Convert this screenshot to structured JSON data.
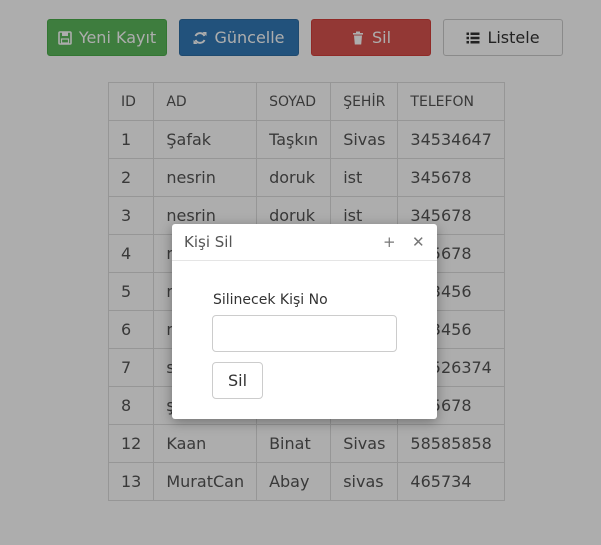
{
  "toolbar": {
    "new_label": "Yeni Kayıt",
    "update_label": "Güncelle",
    "delete_label": "Sil",
    "list_label": "Listele",
    "colors": {
      "success": "#5cb85c",
      "primary": "#337ab7",
      "danger": "#d9534f",
      "default": "#ffffff"
    }
  },
  "table": {
    "headers": [
      "ID",
      "AD",
      "SOYAD",
      "ŞEHİR",
      "TELEFON"
    ],
    "rows": [
      [
        "1",
        "Şafak",
        "Taşkın",
        "Sivas",
        "34534647"
      ],
      [
        "2",
        "nesrin",
        "doruk",
        "ist",
        "345678"
      ],
      [
        "3",
        "nesrin",
        "doruk",
        "ist",
        "345678"
      ],
      [
        "4",
        "n",
        "",
        "",
        "345678"
      ],
      [
        "5",
        "n",
        "",
        "",
        "123456"
      ],
      [
        "6",
        "n",
        "",
        "",
        "123456"
      ],
      [
        "7",
        "s",
        "",
        "",
        "12526374"
      ],
      [
        "8",
        "ş",
        "",
        "",
        "345678"
      ],
      [
        "12",
        "Kaan",
        "Binat",
        "Sivas",
        "58585858"
      ],
      [
        "13",
        "MuratCan",
        "Abay",
        "sivas",
        "465734"
      ]
    ]
  },
  "dialog": {
    "title": "Kişi Sil",
    "field_label": "Silinecek Kişi No",
    "field_value": "",
    "field_placeholder": "",
    "submit_label": "Sil"
  }
}
